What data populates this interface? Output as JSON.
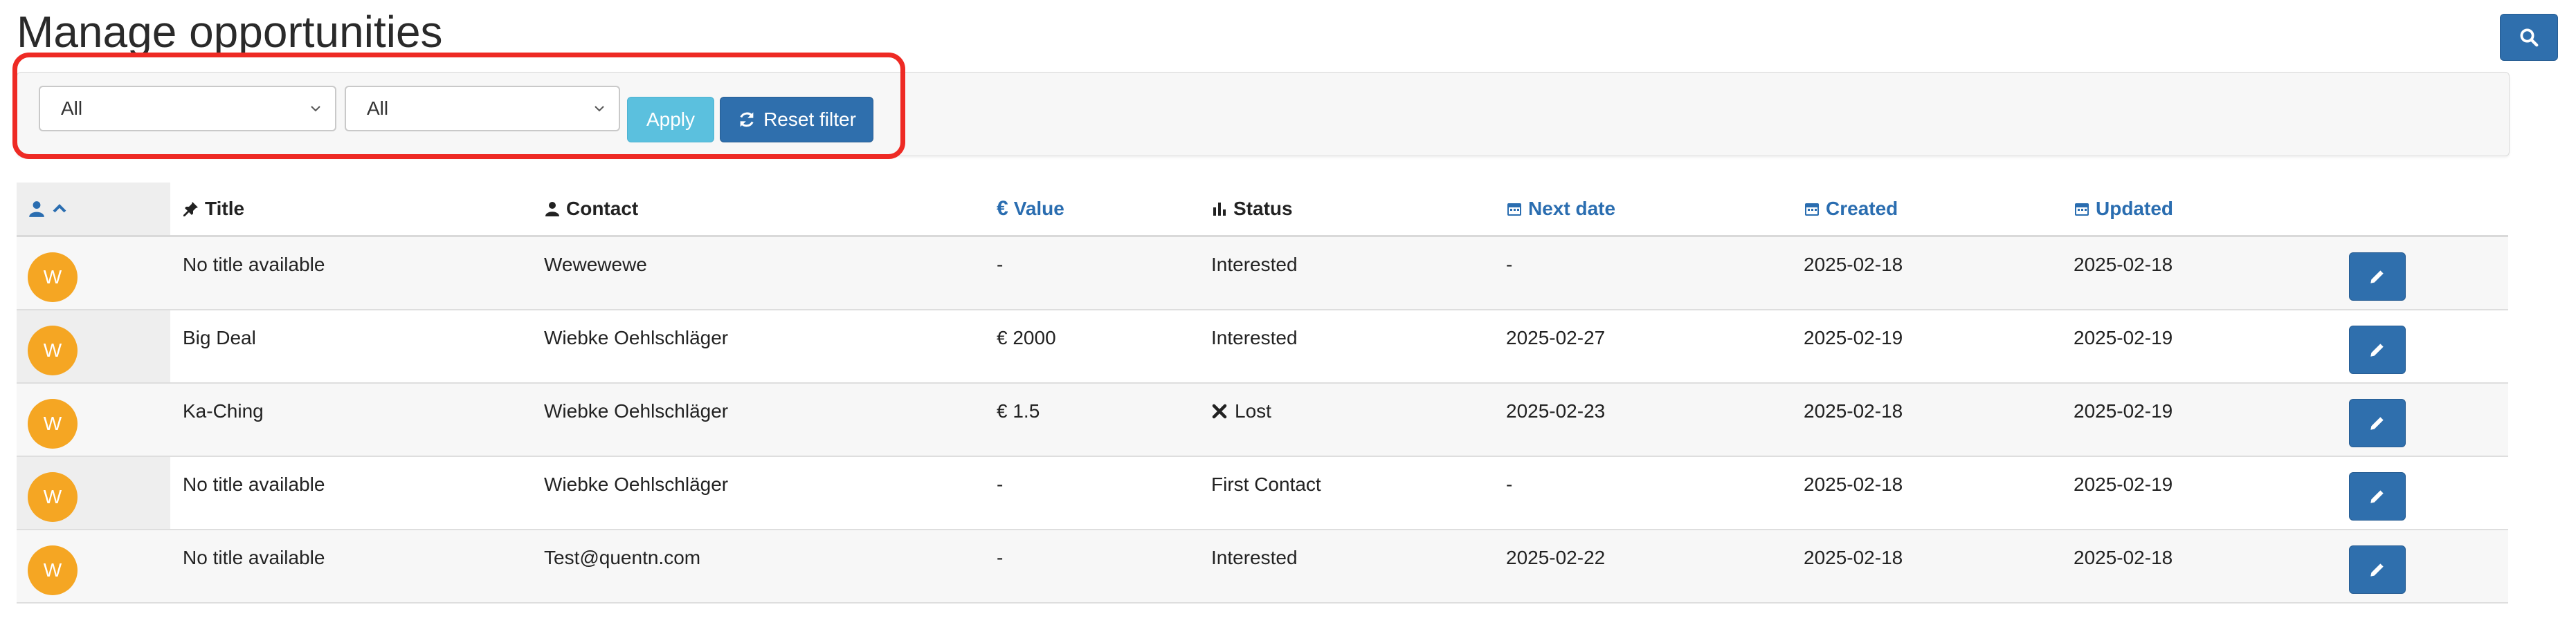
{
  "page": {
    "title": "Manage opportunities"
  },
  "filters": {
    "select_1_value": "All",
    "select_2_value": "All",
    "apply_label": "Apply",
    "reset_label": "Reset filter"
  },
  "colors": {
    "primary": "#2f6fad",
    "info": "#5bc0de",
    "avatar": "#f5a623",
    "link": "#2a6db0",
    "highlight": "#ee2a24"
  },
  "table": {
    "headers": {
      "avatar_icons": [
        "user-icon",
        "chevron-up-icon"
      ],
      "title": "Title",
      "contact": "Contact",
      "value": "Value",
      "status": "Status",
      "next_date": "Next date",
      "created": "Created",
      "updated": "Updated"
    },
    "rows": [
      {
        "avatar": "W",
        "title": "No title available",
        "contact": "Wewewewe",
        "value": "-",
        "status": "Interested",
        "status_icon": "",
        "next_date": "-",
        "created": "2025-02-18",
        "updated": "2025-02-18"
      },
      {
        "avatar": "W",
        "title": "Big Deal",
        "contact": "Wiebke Oehlschläger",
        "value": "€ 2000",
        "status": "Interested",
        "status_icon": "",
        "next_date": "2025-02-27",
        "created": "2025-02-19",
        "updated": "2025-02-19"
      },
      {
        "avatar": "W",
        "title": "Ka-Ching",
        "contact": "Wiebke Oehlschläger",
        "value": "€ 1.5",
        "status": "Lost",
        "status_icon": "close-icon",
        "next_date": "2025-02-23",
        "created": "2025-02-18",
        "updated": "2025-02-19"
      },
      {
        "avatar": "W",
        "title": "No title available",
        "contact": "Wiebke Oehlschläger",
        "value": "-",
        "status": "First Contact",
        "status_icon": "",
        "next_date": "-",
        "created": "2025-02-18",
        "updated": "2025-02-19"
      },
      {
        "avatar": "W",
        "title": "No title available",
        "contact": "Test@quentn.com",
        "value": "-",
        "status": "Interested",
        "status_icon": "",
        "next_date": "2025-02-22",
        "created": "2025-02-18",
        "updated": "2025-02-18"
      }
    ]
  }
}
